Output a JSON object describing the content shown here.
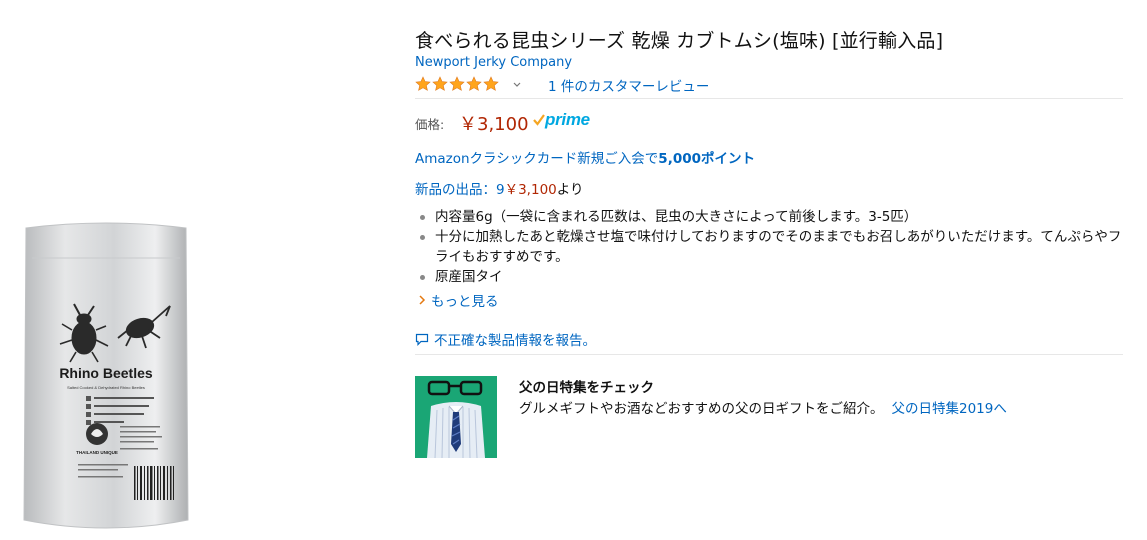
{
  "product": {
    "title": "食べられる昆虫シリーズ 乾燥 カブトムシ(塩味) [並行輸入品]",
    "brand": "Newport Jerky Company",
    "rating_stars": 5,
    "review_link": "1 件のカスタマーレビュー",
    "price_label": "価格:",
    "price": "￥3,100",
    "prime_label": "prime",
    "card_offer_prefix": "Amazonクラシックカード新規ご入会で",
    "card_offer_points": "5,000ポイント",
    "offers_prefix": "新品の出品：",
    "offers_count": "9",
    "offers_price": "￥3,100",
    "offers_suffix": "より",
    "bullets": [
      "内容量6g（一袋に含まれる匹数は、昆虫の大きさによって前後します。3-5匹）",
      "十分に加熱したあと乾燥させ塩で味付けしておりますのでそのままでもお召しあがりいただけます。てんぷらやフライもおすすめです。",
      "原産国タイ"
    ],
    "see_more": "もっと見る",
    "report": "不正確な製品情報を報告。",
    "package": {
      "name": "Rhino Beetles",
      "sub": "Salted Cooked & Dehydrated Rhino Beetles",
      "brand": "THAILAND UNIQUE"
    }
  },
  "promo": {
    "heading": "父の日特集をチェック",
    "description": "グルメギフトやお酒などおすすめの父の日ギフトをご紹介。",
    "link": "父の日特集2019へ"
  },
  "colors": {
    "link": "#0066c0",
    "price": "#b12704",
    "star": "#ffa41c",
    "prime": "#00a8e1",
    "promo_bg": "#1aa675"
  },
  "icons": {
    "rating": "star-icon",
    "dropdown": "chevron-down-icon",
    "more": "chevron-right-icon",
    "report": "speech-bubble-icon",
    "prime": "prime-check-icon"
  }
}
